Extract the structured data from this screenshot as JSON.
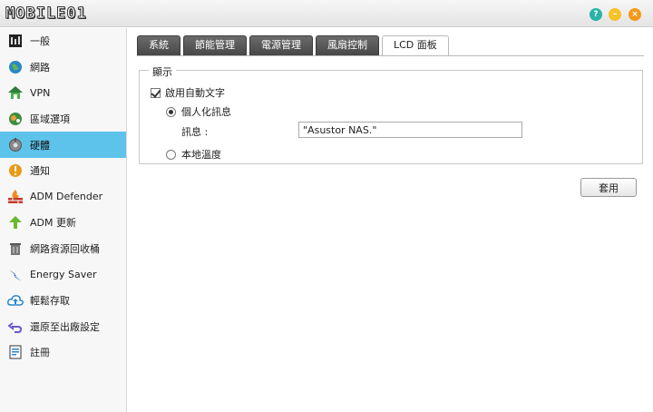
{
  "window": {
    "logo_text": "MOBILE01",
    "help_symbol": "?",
    "min_symbol": "–",
    "close_symbol": "×"
  },
  "sidebar": {
    "items": [
      {
        "label": "一般",
        "icon": "general-icon"
      },
      {
        "label": "網路",
        "icon": "globe-icon"
      },
      {
        "label": "VPN",
        "icon": "vpn-house-icon"
      },
      {
        "label": "區域選項",
        "icon": "region-icon"
      },
      {
        "label": "硬體",
        "icon": "hardware-icon",
        "active": true
      },
      {
        "label": "通知",
        "icon": "notification-icon"
      },
      {
        "label": "ADM Defender",
        "icon": "firewall-icon"
      },
      {
        "label": "ADM 更新",
        "icon": "update-arrow-icon"
      },
      {
        "label": "網路資源回收桶",
        "icon": "recycle-bin-icon"
      },
      {
        "label": "Energy Saver",
        "icon": "energy-bolt-icon"
      },
      {
        "label": "輕鬆存取",
        "icon": "cloud-upload-icon"
      },
      {
        "label": "還原至出廠設定",
        "icon": "restore-icon"
      },
      {
        "label": "註冊",
        "icon": "register-icon"
      }
    ]
  },
  "tabs": [
    {
      "label": "系統"
    },
    {
      "label": "節能管理"
    },
    {
      "label": "電源管理"
    },
    {
      "label": "風扇控制"
    },
    {
      "label": "LCD 面板",
      "active": true
    }
  ],
  "panel": {
    "title": "顯示",
    "enable_auto_text": "啟用自動文字",
    "personal_message": "個人化訊息",
    "message_label": "訊息 :",
    "message_value": "\"Asustor NAS.\"",
    "local_temperature": "本地溫度"
  },
  "apply_label": "套用",
  "colors": {
    "sidebar_active": "#5ec3ea",
    "tab_dark": "#474747"
  }
}
